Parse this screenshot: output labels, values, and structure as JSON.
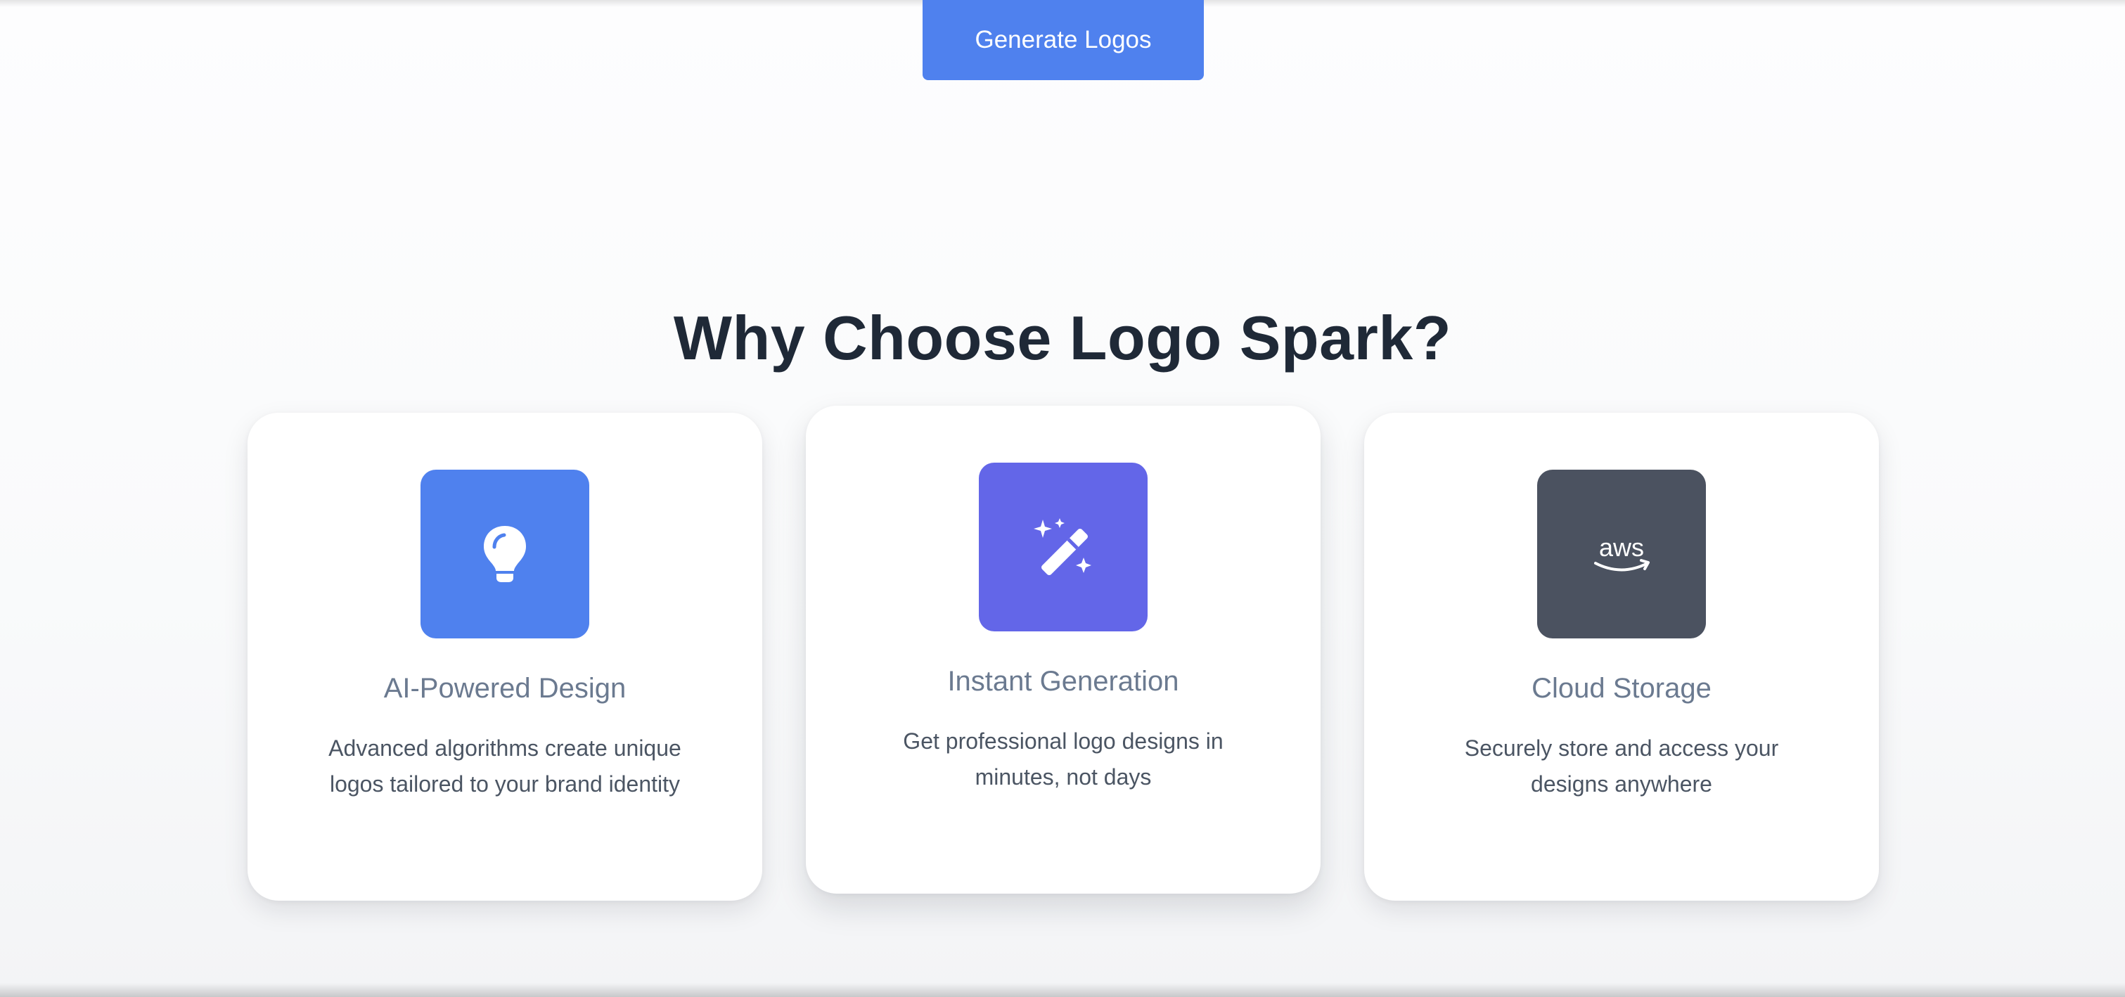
{
  "hero": {
    "generate_button_label": "Generate Logos"
  },
  "features": {
    "title": "Why Choose Logo Spark?",
    "cards": [
      {
        "icon": "lightbulb-icon",
        "icon_bg": "#4f81ee",
        "title": "AI-Powered Design",
        "description": "Advanced algorithms create unique logos tailored to your brand identity"
      },
      {
        "icon": "magic-wand-icon",
        "icon_bg": "#6366e8",
        "title": "Instant Generation",
        "description": "Get professional logo designs in minutes, not days"
      },
      {
        "icon": "aws-icon",
        "icon_bg": "#4b5260",
        "title": "Cloud Storage",
        "description": "Securely store and access your designs anywhere"
      }
    ]
  }
}
